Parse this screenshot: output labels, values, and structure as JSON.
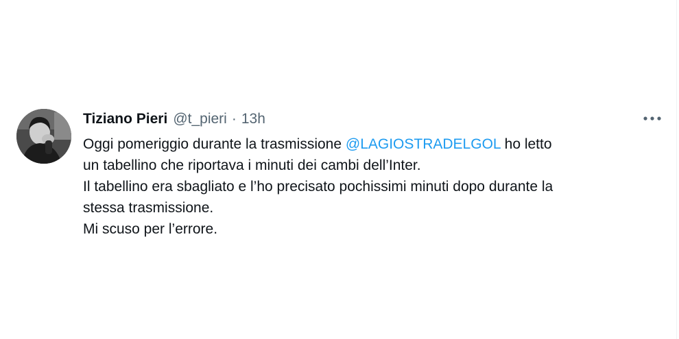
{
  "tweet": {
    "author_name": "Tiziano Pieri",
    "handle": "@t_pieri",
    "separator": "·",
    "time": "13h",
    "more_icon": "more-horizontal-icon",
    "avatar_icon": "profile-photo",
    "lines": [
      {
        "before": "Oggi pomeriggio durante la trasmissione ",
        "mention": "@LAGIOSTRADELGOL",
        "after": " ho letto"
      },
      {
        "text": "un tabellino che riportava i minuti dei cambi dell’Inter."
      },
      {
        "text": "Il tabellino era sbagliato e l’ho precisato pochissimi minuti dopo durante la"
      },
      {
        "text": "stessa trasmissione."
      },
      {
        "text": "Mi scuso per l’errore."
      }
    ]
  },
  "colors": {
    "text": "#0f1419",
    "secondary": "#536471",
    "link": "#1d9bf0",
    "background": "#ffffff"
  }
}
